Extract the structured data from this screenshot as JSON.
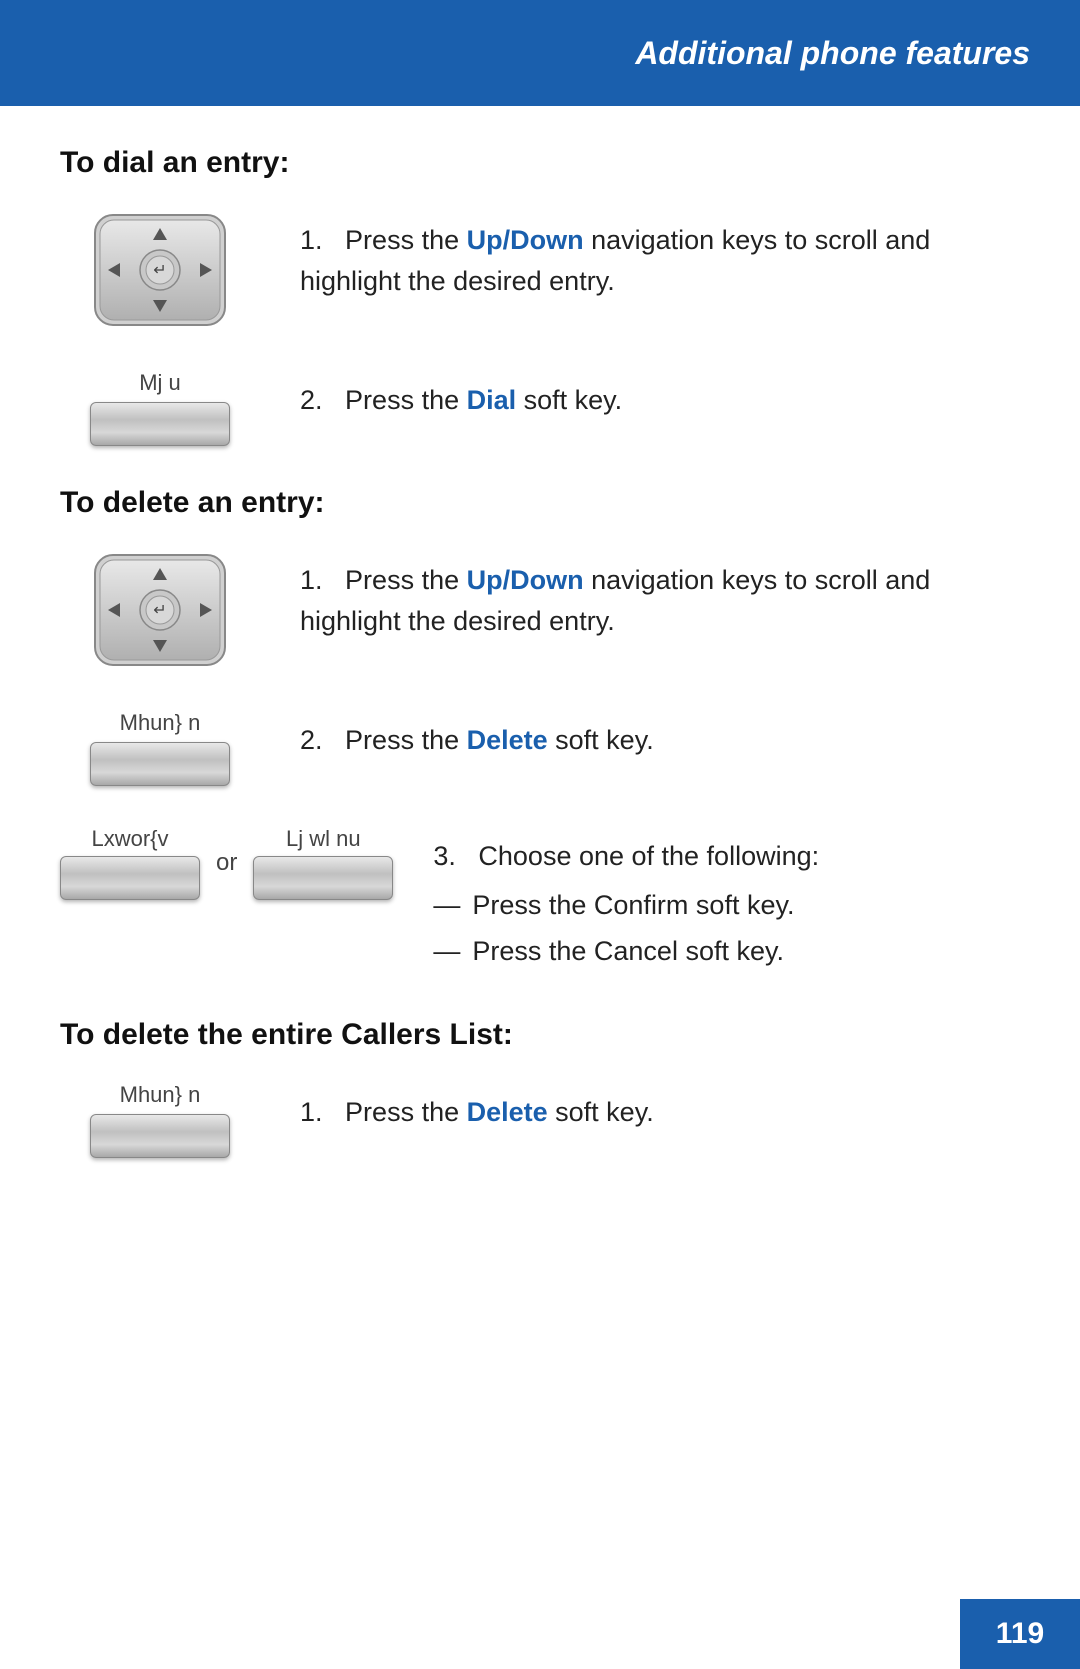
{
  "header": {
    "title": "Additional phone features",
    "background": "#1a5fad"
  },
  "sections": [
    {
      "id": "dial",
      "heading": "To dial an entry:",
      "steps": [
        {
          "type": "nav-key",
          "number": "1.",
          "text_before": "Press the ",
          "highlight": "Up/Down",
          "text_after": " navigation keys to scroll and highlight the desired entry."
        },
        {
          "type": "soft-key",
          "label": "Mj u",
          "number": "2.",
          "text_before": "Press the ",
          "highlight": "Dial",
          "text_after": " soft key."
        }
      ]
    },
    {
      "id": "delete-entry",
      "heading": "To delete an entry:",
      "steps": [
        {
          "type": "nav-key",
          "number": "1.",
          "text_before": "Press the ",
          "highlight": "Up/Down",
          "text_after": " navigation keys to scroll and highlight the desired entry."
        },
        {
          "type": "soft-key",
          "label": "Mhun} n",
          "number": "2.",
          "text_before": "Press the ",
          "highlight": "Delete",
          "text_after": " soft key."
        },
        {
          "type": "dual-soft-key",
          "label1": "Lxwor{v",
          "label2": "Lj wl nu",
          "number": "3.",
          "intro": "Choose one of the following:",
          "sub": [
            {
              "text_before": "Press the ",
              "highlight": "Confirm",
              "text_after": " soft key."
            },
            {
              "text_before": "Press the ",
              "highlight": "Cancel",
              "text_after": " soft key."
            }
          ]
        }
      ]
    },
    {
      "id": "delete-all",
      "heading": "To delete the entire Callers List:",
      "steps": [
        {
          "type": "soft-key",
          "label": "Mhun} n",
          "number": "1.",
          "text_before": "Press the ",
          "highlight": "Delete",
          "text_after": " soft key."
        }
      ]
    }
  ],
  "page": {
    "number": "119"
  }
}
